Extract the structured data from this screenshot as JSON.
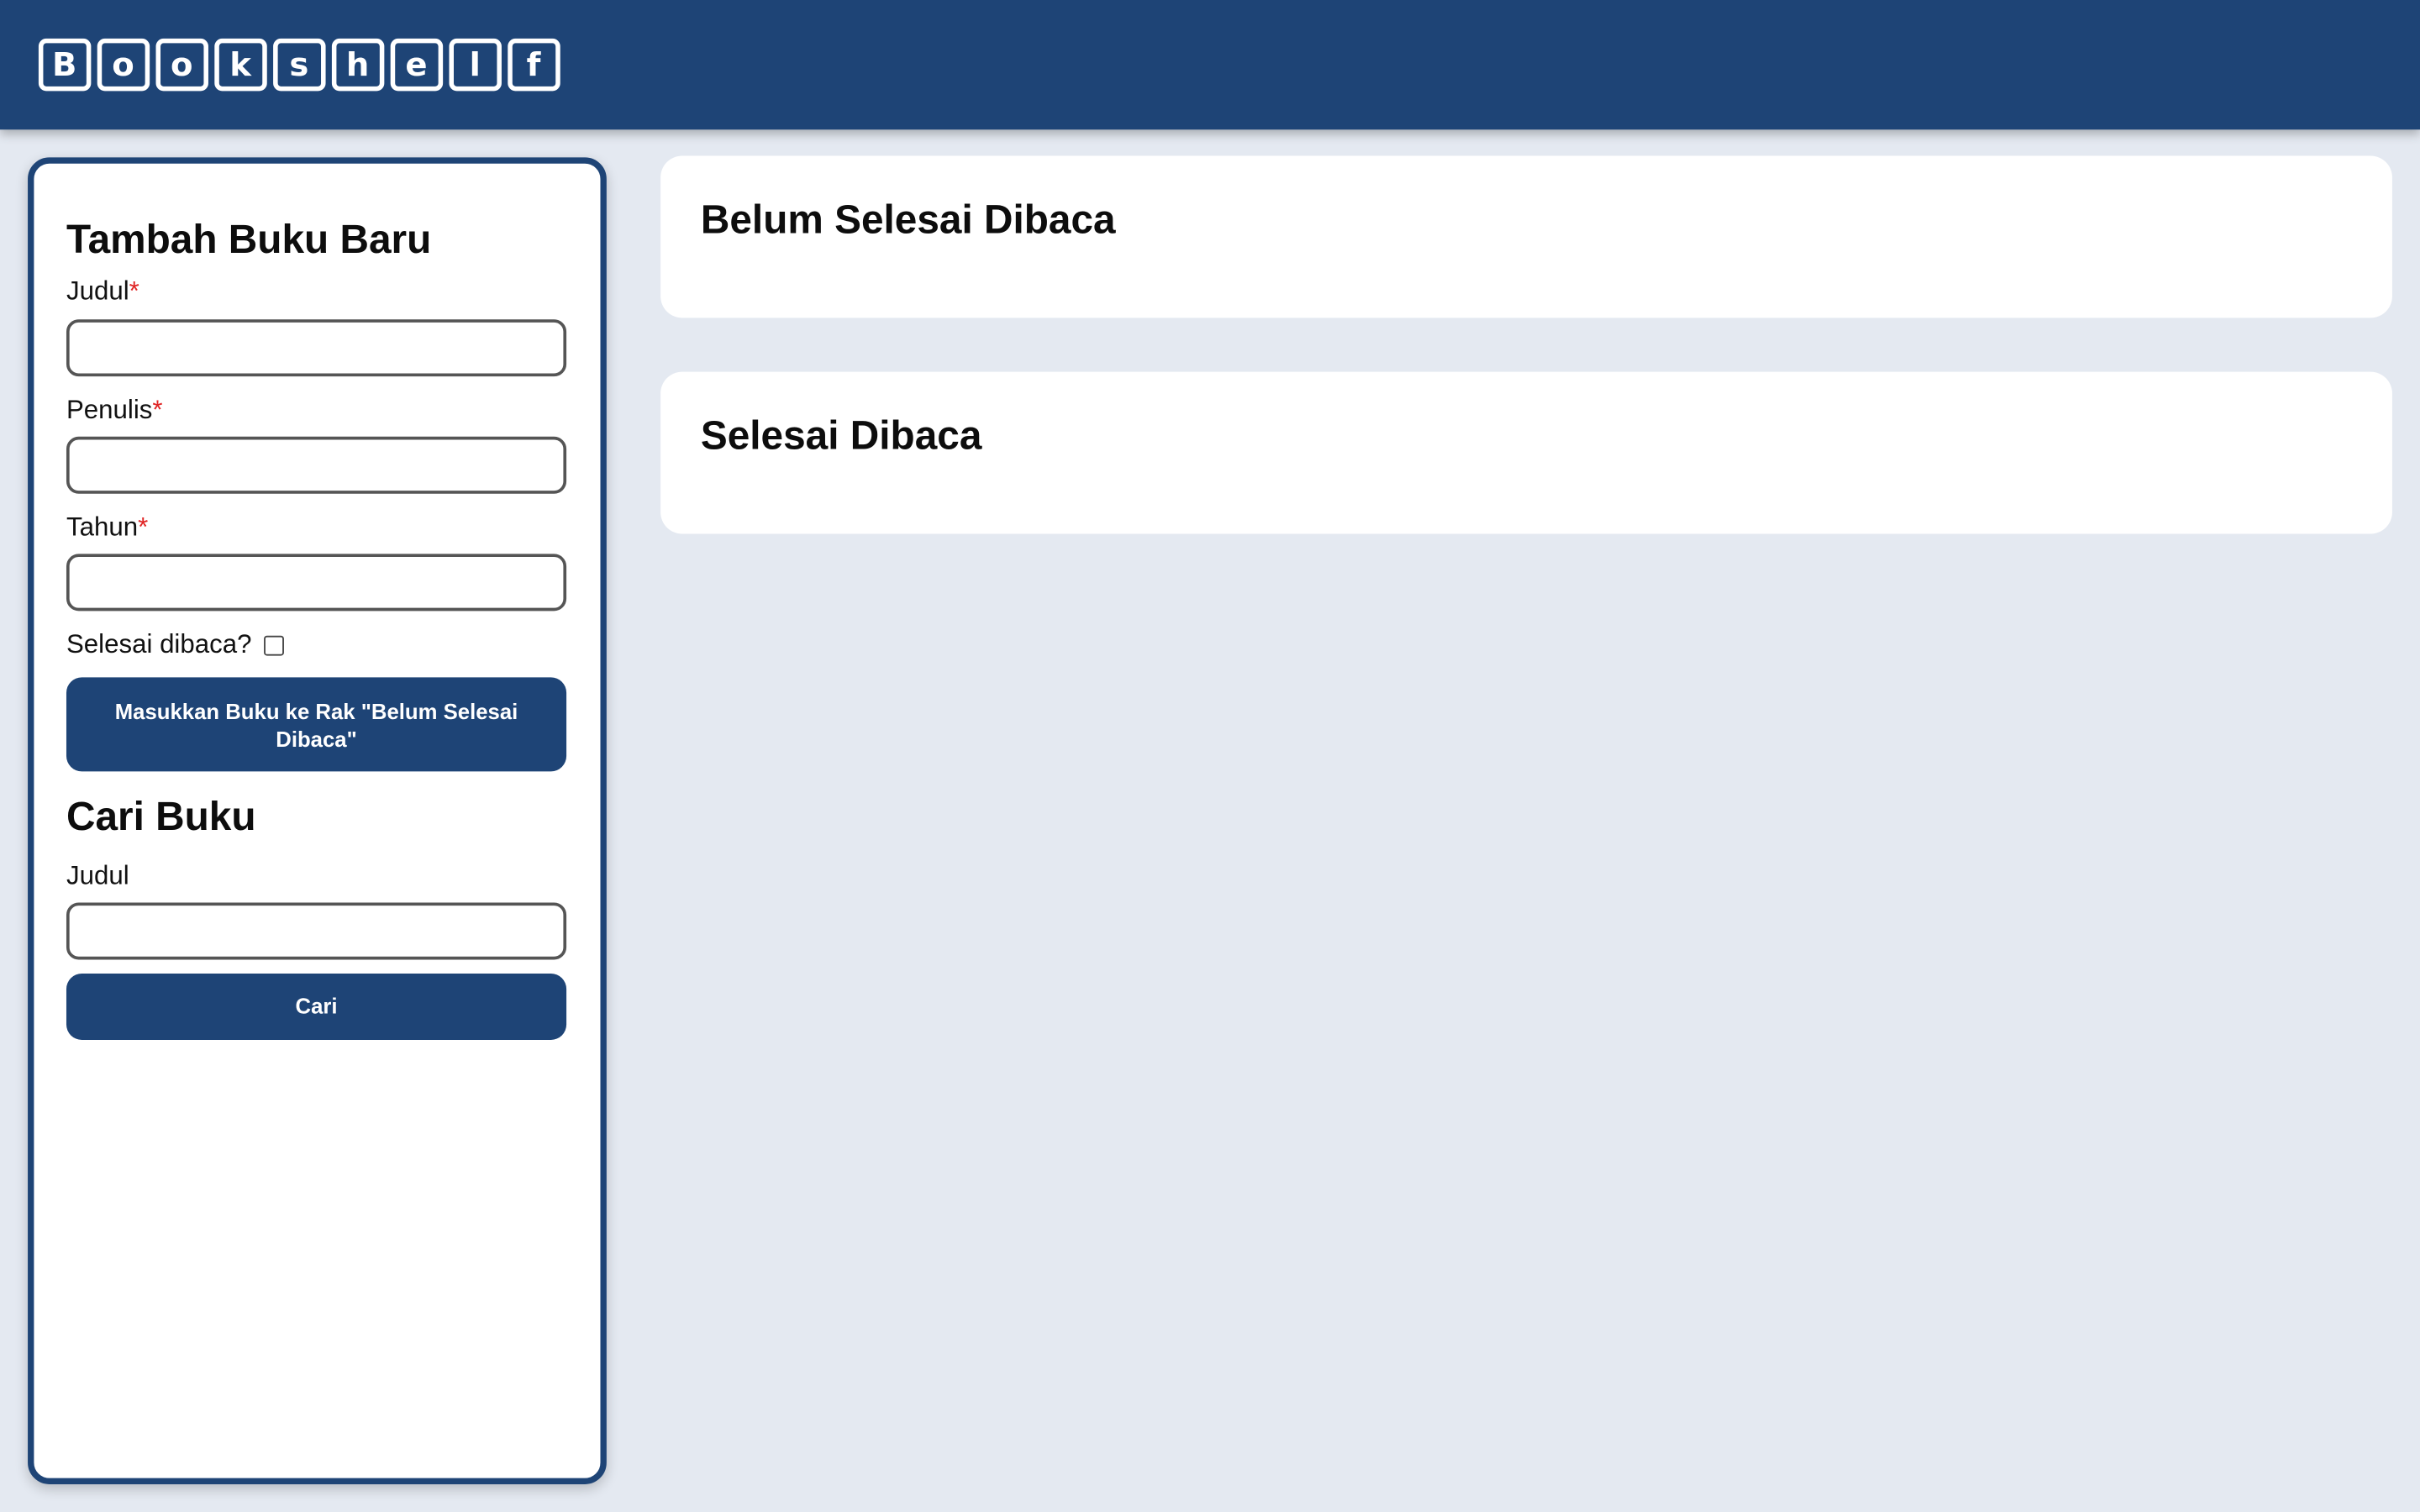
{
  "header": {
    "logo_letters": [
      "B",
      "o",
      "o",
      "k",
      "s",
      "h",
      "e",
      "l",
      "f"
    ]
  },
  "add_form": {
    "title": "Tambah Buku Baru",
    "title_label": "Judul",
    "author_label": "Penulis",
    "year_label": "Tahun",
    "required_marker": "*",
    "finished_label": "Selesai dibaca?",
    "finished_checked": false,
    "title_value": "",
    "author_value": "",
    "year_value": "",
    "submit_label": "Masukkan Buku ke Rak \"Belum Selesai Dibaca\""
  },
  "search_form": {
    "title": "Cari Buku",
    "title_label": "Judul",
    "query_value": "",
    "submit_label": "Cari"
  },
  "shelves": {
    "unfinished_title": "Belum Selesai Dibaca",
    "finished_title": "Selesai Dibaca"
  },
  "colors": {
    "brand": "#1e4476",
    "background": "#e4e9f1",
    "required": "#e02424"
  }
}
